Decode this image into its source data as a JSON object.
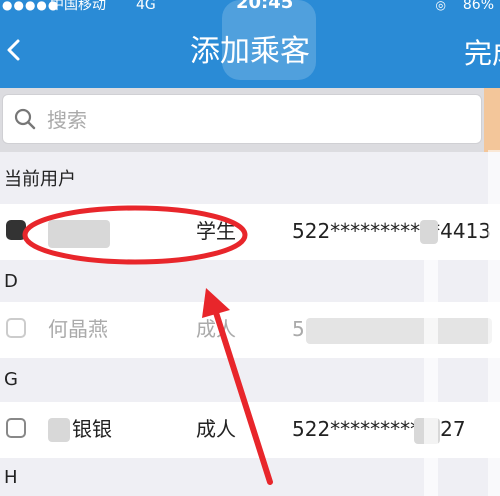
{
  "status_bar": {
    "signal": "●●●●●",
    "carrier": "中国移动",
    "network": "4G",
    "time": "20:45",
    "rotation_lock": "◎",
    "battery": "86%"
  },
  "nav": {
    "title": "添加乘客",
    "done_label": "完成"
  },
  "search": {
    "placeholder": "搜索"
  },
  "sections": [
    {
      "label": "当前用户",
      "rows": [
        {
          "checked": true,
          "name": "",
          "type": "学生",
          "id_number": "522***********4413"
        }
      ]
    },
    {
      "label": "D",
      "rows": [
        {
          "checked": false,
          "name": "何晶燕",
          "type": "成人",
          "id_number": "5"
        }
      ]
    },
    {
      "label": "G",
      "rows": [
        {
          "checked": false,
          "name": "银银",
          "type": "成人",
          "id_number": "522***********27"
        }
      ]
    },
    {
      "label": "H",
      "rows": []
    }
  ],
  "colors": {
    "header": "#2a8bd6",
    "annotation": "#e8262b",
    "page_bg": "#efeff4"
  }
}
